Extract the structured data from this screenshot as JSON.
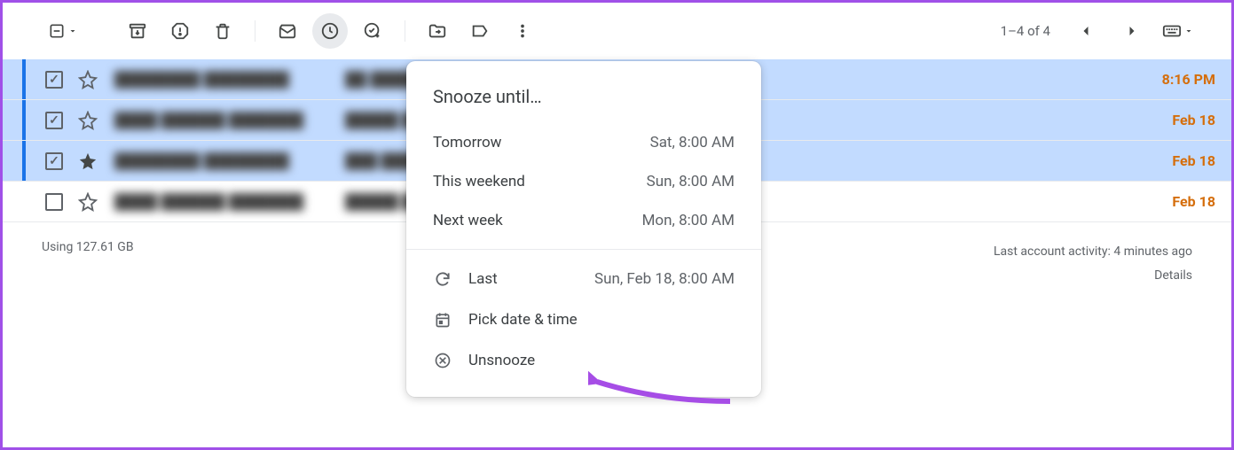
{
  "toolbar": {
    "pager": "1–4 of 4"
  },
  "rows": [
    {
      "selected": true,
      "checked": true,
      "starred": false,
      "sender": "████████ ████████",
      "subject": "██ █████ ██████████ ██████",
      "date": "8:16 PM"
    },
    {
      "selected": true,
      "checked": true,
      "starred": false,
      "sender": "████ ██████ ███████",
      "subject": "█████ ███ ███ ████████ █████",
      "date": "Feb 18"
    },
    {
      "selected": true,
      "checked": true,
      "starred": true,
      "sender": "████████ ████████",
      "subject": "███ ████████ ████ ██████ ███",
      "date": "Feb 18"
    },
    {
      "selected": false,
      "checked": false,
      "starred": false,
      "sender": "████ ██████ ███████",
      "subject": "█████ ███ ████████ ██ █████",
      "date": "Feb 18"
    }
  ],
  "snooze": {
    "title": "Snooze until…",
    "opts": [
      {
        "label": "Tomorrow",
        "time": "Sat, 8:00 AM"
      },
      {
        "label": "This weekend",
        "time": "Sun, 8:00 AM"
      },
      {
        "label": "Next week",
        "time": "Mon, 8:00 AM"
      }
    ],
    "lastLabel": "Last",
    "lastTime": "Sun, Feb 18, 8:00 AM",
    "pick": "Pick date & time",
    "unsnooze": "Unsnooze"
  },
  "footer": {
    "storage": "Using 127.61 GB",
    "activity": "Last account activity: 4 minutes ago",
    "details": "Details"
  }
}
